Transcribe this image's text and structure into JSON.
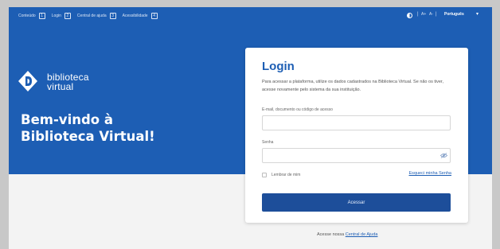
{
  "accessibility_bar": {
    "items": [
      {
        "label": "Conteúdo",
        "key": "1"
      },
      {
        "label": "Login",
        "key": "2"
      },
      {
        "label": "Central de ajuda",
        "key": "3"
      },
      {
        "label": "Acessibilidade",
        "key": "4"
      }
    ],
    "font_increase": "A+",
    "font_decrease": "A-",
    "separator": "|",
    "language": "Português",
    "language_caret": "▾"
  },
  "brand": {
    "name_line1": "biblioteca",
    "name_line2": "virtual",
    "welcome_line1": "Bem-vindo à",
    "welcome_line2": "Biblioteca Virtual!"
  },
  "login": {
    "title": "Login",
    "description": "Para acessar a plataforma, utilize os dados cadastrados na Biblioteca Virtual. Se não os tiver, acesse novamente pelo sistema da sua instituição.",
    "email_label": "E-mail, documento ou código de acesso",
    "email_value": "",
    "password_label": "Senha",
    "password_value": "",
    "remember_label": "Lembrar de mim",
    "forgot_link": "Esqueci minha Senha",
    "submit_label": "Acessar"
  },
  "footer": {
    "help_prefix": "Acesse nossa",
    "help_link": "Central de Ajuda"
  },
  "colors": {
    "brand_blue": "#1d5eb4",
    "button_blue": "#1d4e9a",
    "page_bg": "#f3f3f3"
  }
}
